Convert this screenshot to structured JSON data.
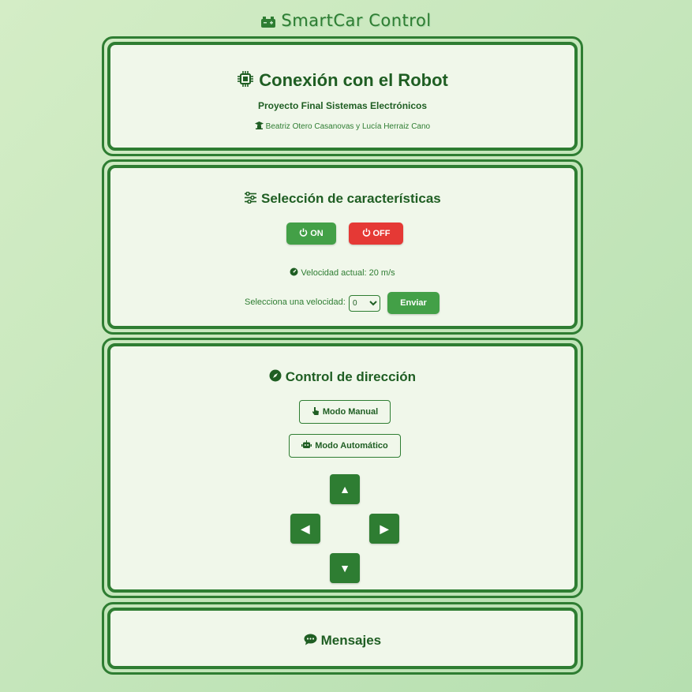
{
  "header": {
    "title": "SmartCar Control",
    "icon": "car-battery-icon"
  },
  "connection": {
    "title": "Conexión con el Robot",
    "subtitle": "Proyecto Final Sistemas Electrónicos",
    "authors": "Beatriz Otero Casanovas y Lucía Herraiz Cano"
  },
  "features": {
    "title": "Selección de características",
    "on_label": "ON",
    "off_label": "OFF",
    "speed_text": "Velocidad actual: 20 m/s",
    "select_label": "Selecciona una velocidad:",
    "select_value": "0",
    "send_label": "Enviar"
  },
  "direction": {
    "title": "Control de dirección",
    "manual_label": "Modo Manual",
    "auto_label": "Modo Automático",
    "up": "▲",
    "left": "◀",
    "right": "▶",
    "down": "▼"
  },
  "messages": {
    "title": "Mensajes"
  },
  "colors": {
    "primary": "#2e7d32",
    "button_green": "#43a047",
    "button_red": "#e53935",
    "card_bg": "#f0f7ea"
  }
}
